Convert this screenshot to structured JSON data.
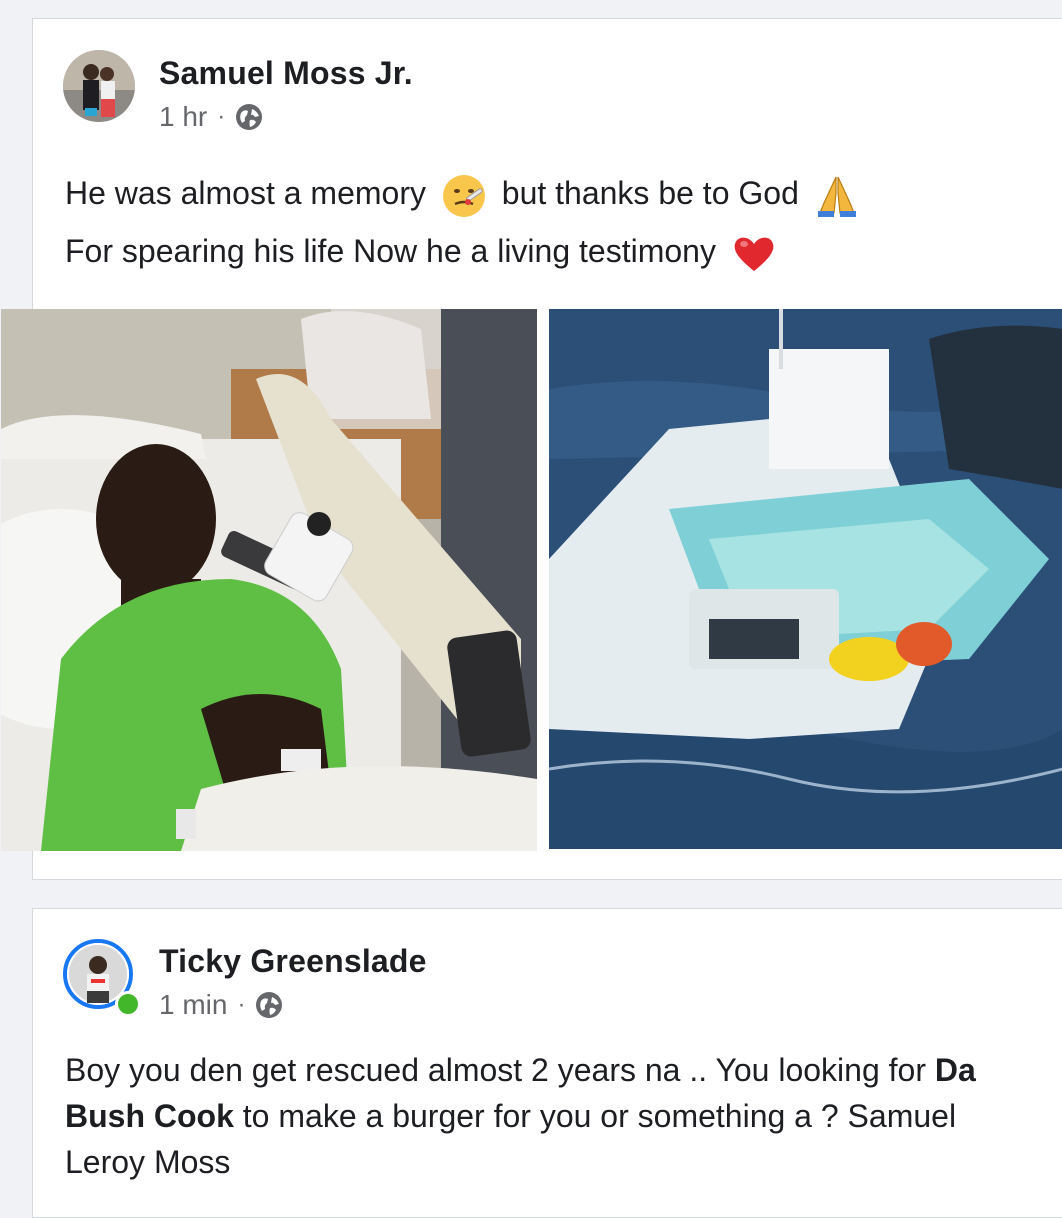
{
  "post1": {
    "author": "Samuel Moss Jr.",
    "time": "1 hr",
    "separator": "·",
    "icons": {
      "privacy": "globe-icon",
      "emoji1": "face-with-thermometer-emoji",
      "emoji2": "folded-hands-emoji",
      "emoji3": "red-heart-emoji"
    },
    "text_line1_a": "He was almost a memory",
    "text_line1_b": "but thanks be to God",
    "text_line2": "For spearing his life Now he a living testimony",
    "photos": [
      "hospital-bed-photo",
      "sinking-boat-rescue-photo"
    ]
  },
  "post2": {
    "author": "Ticky Greenslade",
    "time": "1 min",
    "separator": "·",
    "icons": {
      "privacy": "globe-icon",
      "online": "online-status-dot"
    },
    "text_a": "Boy you den get rescued almost 2 years na .. You looking for ",
    "text_mention": "Da Bush Cook",
    "text_b": " to make a burger for you or something a ?  Samuel Leroy Moss"
  },
  "colors": {
    "background": "#f0f2f5",
    "card": "#ffffff",
    "meta": "#65676b",
    "online": "#42b72a",
    "avatar_ring": "#1877f2"
  }
}
